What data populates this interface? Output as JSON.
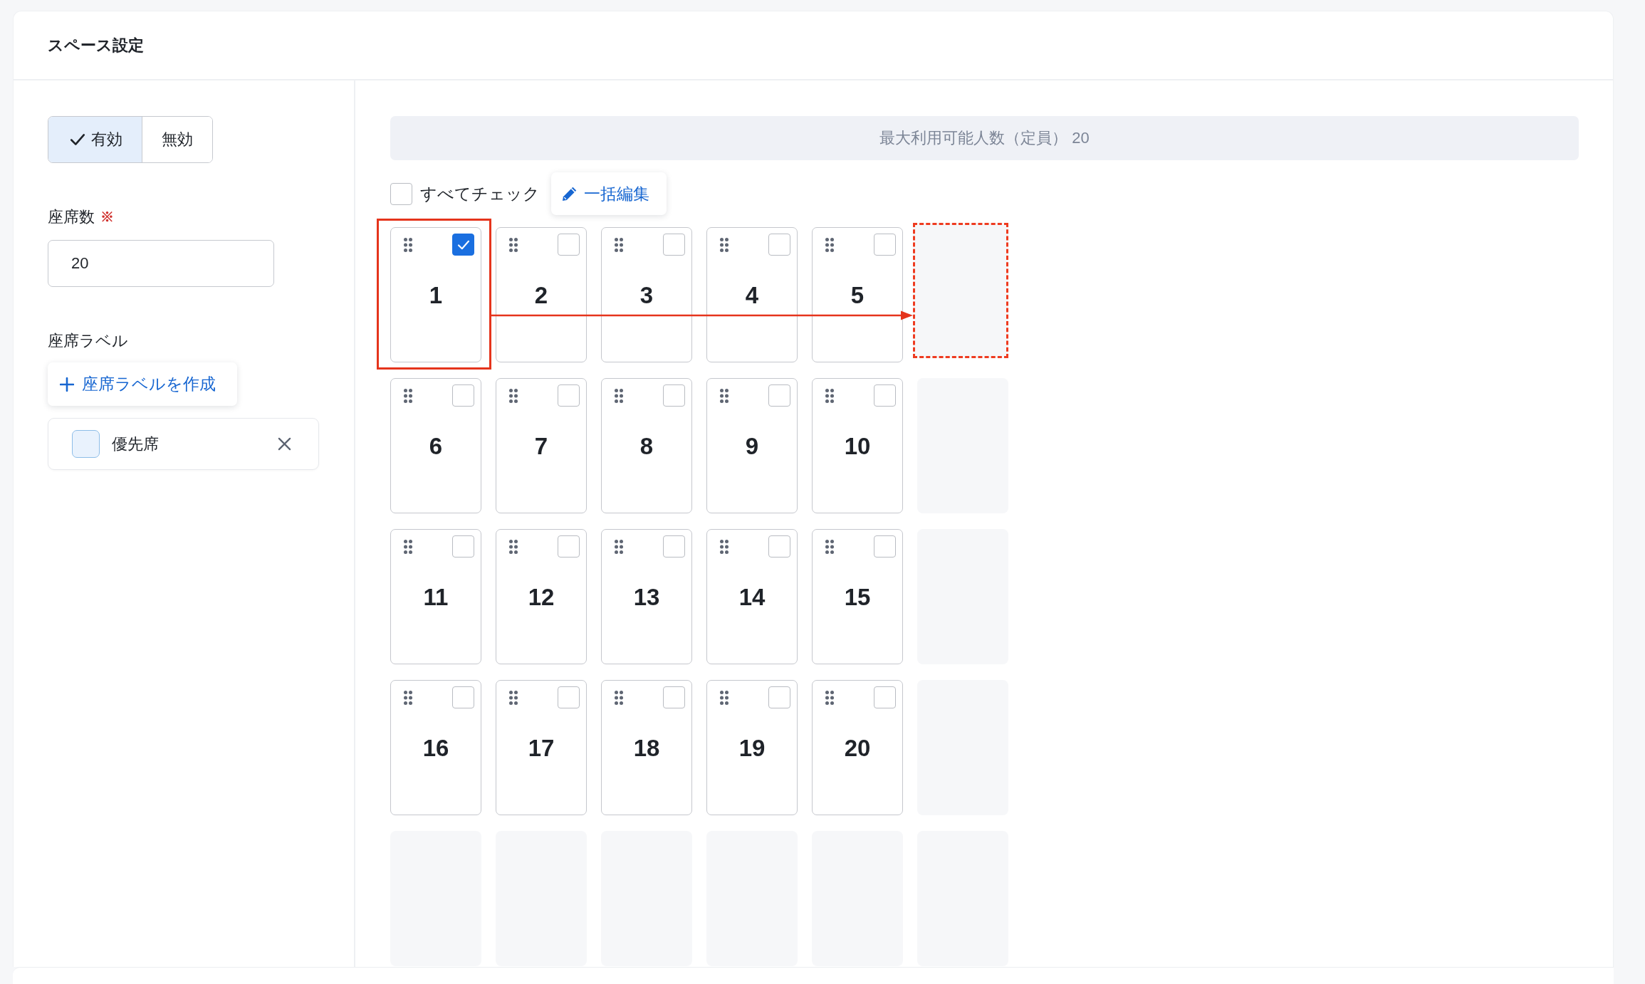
{
  "panel": {
    "title": "スペース設定"
  },
  "status_toggle": [
    {
      "label": "有効",
      "selected": true
    },
    {
      "label": "無効",
      "selected": false
    }
  ],
  "seat_count": {
    "label": "座席数",
    "required_mark": "※",
    "value": "20"
  },
  "seat_labels": {
    "label": "座席ラベル",
    "create_button": "座席ラベルを作成",
    "items": [
      {
        "name": "優先席",
        "color": "#e9f2fd"
      }
    ]
  },
  "capacity_banner": "最大利用可能人数（定員） 20",
  "select_all": {
    "label": "すべてチェック",
    "checked": false
  },
  "bulk_edit_button": "一括編集",
  "seat_grid": {
    "rows": [
      [
        {
          "kind": "seat",
          "label": "1",
          "checked": true,
          "highlighted": true
        },
        {
          "kind": "seat",
          "label": "2",
          "checked": false,
          "highlighted": false
        },
        {
          "kind": "seat",
          "label": "3",
          "checked": false,
          "highlighted": false
        },
        {
          "kind": "seat",
          "label": "4",
          "checked": false,
          "highlighted": false
        },
        {
          "kind": "seat",
          "label": "5",
          "checked": false,
          "highlighted": false
        },
        {
          "kind": "empty",
          "drop_target": true
        }
      ],
      [
        {
          "kind": "seat",
          "label": "6",
          "checked": false,
          "highlighted": false
        },
        {
          "kind": "seat",
          "label": "7",
          "checked": false,
          "highlighted": false
        },
        {
          "kind": "seat",
          "label": "8",
          "checked": false,
          "highlighted": false
        },
        {
          "kind": "seat",
          "label": "9",
          "checked": false,
          "highlighted": false
        },
        {
          "kind": "seat",
          "label": "10",
          "checked": false,
          "highlighted": false
        },
        {
          "kind": "empty",
          "drop_target": false
        }
      ],
      [
        {
          "kind": "seat",
          "label": "11",
          "checked": false,
          "highlighted": false
        },
        {
          "kind": "seat",
          "label": "12",
          "checked": false,
          "highlighted": false
        },
        {
          "kind": "seat",
          "label": "13",
          "checked": false,
          "highlighted": false
        },
        {
          "kind": "seat",
          "label": "14",
          "checked": false,
          "highlighted": false
        },
        {
          "kind": "seat",
          "label": "15",
          "checked": false,
          "highlighted": false
        },
        {
          "kind": "empty",
          "drop_target": false
        }
      ],
      [
        {
          "kind": "seat",
          "label": "16",
          "checked": false,
          "highlighted": false
        },
        {
          "kind": "seat",
          "label": "17",
          "checked": false,
          "highlighted": false
        },
        {
          "kind": "seat",
          "label": "18",
          "checked": false,
          "highlighted": false
        },
        {
          "kind": "seat",
          "label": "19",
          "checked": false,
          "highlighted": false
        },
        {
          "kind": "seat",
          "label": "20",
          "checked": false,
          "highlighted": false
        },
        {
          "kind": "empty",
          "drop_target": false
        }
      ],
      [
        {
          "kind": "empty",
          "drop_target": false
        },
        {
          "kind": "empty",
          "drop_target": false
        },
        {
          "kind": "empty",
          "drop_target": false
        },
        {
          "kind": "empty",
          "drop_target": false
        },
        {
          "kind": "empty",
          "drop_target": false
        },
        {
          "kind": "empty",
          "drop_target": false
        }
      ]
    ]
  }
}
